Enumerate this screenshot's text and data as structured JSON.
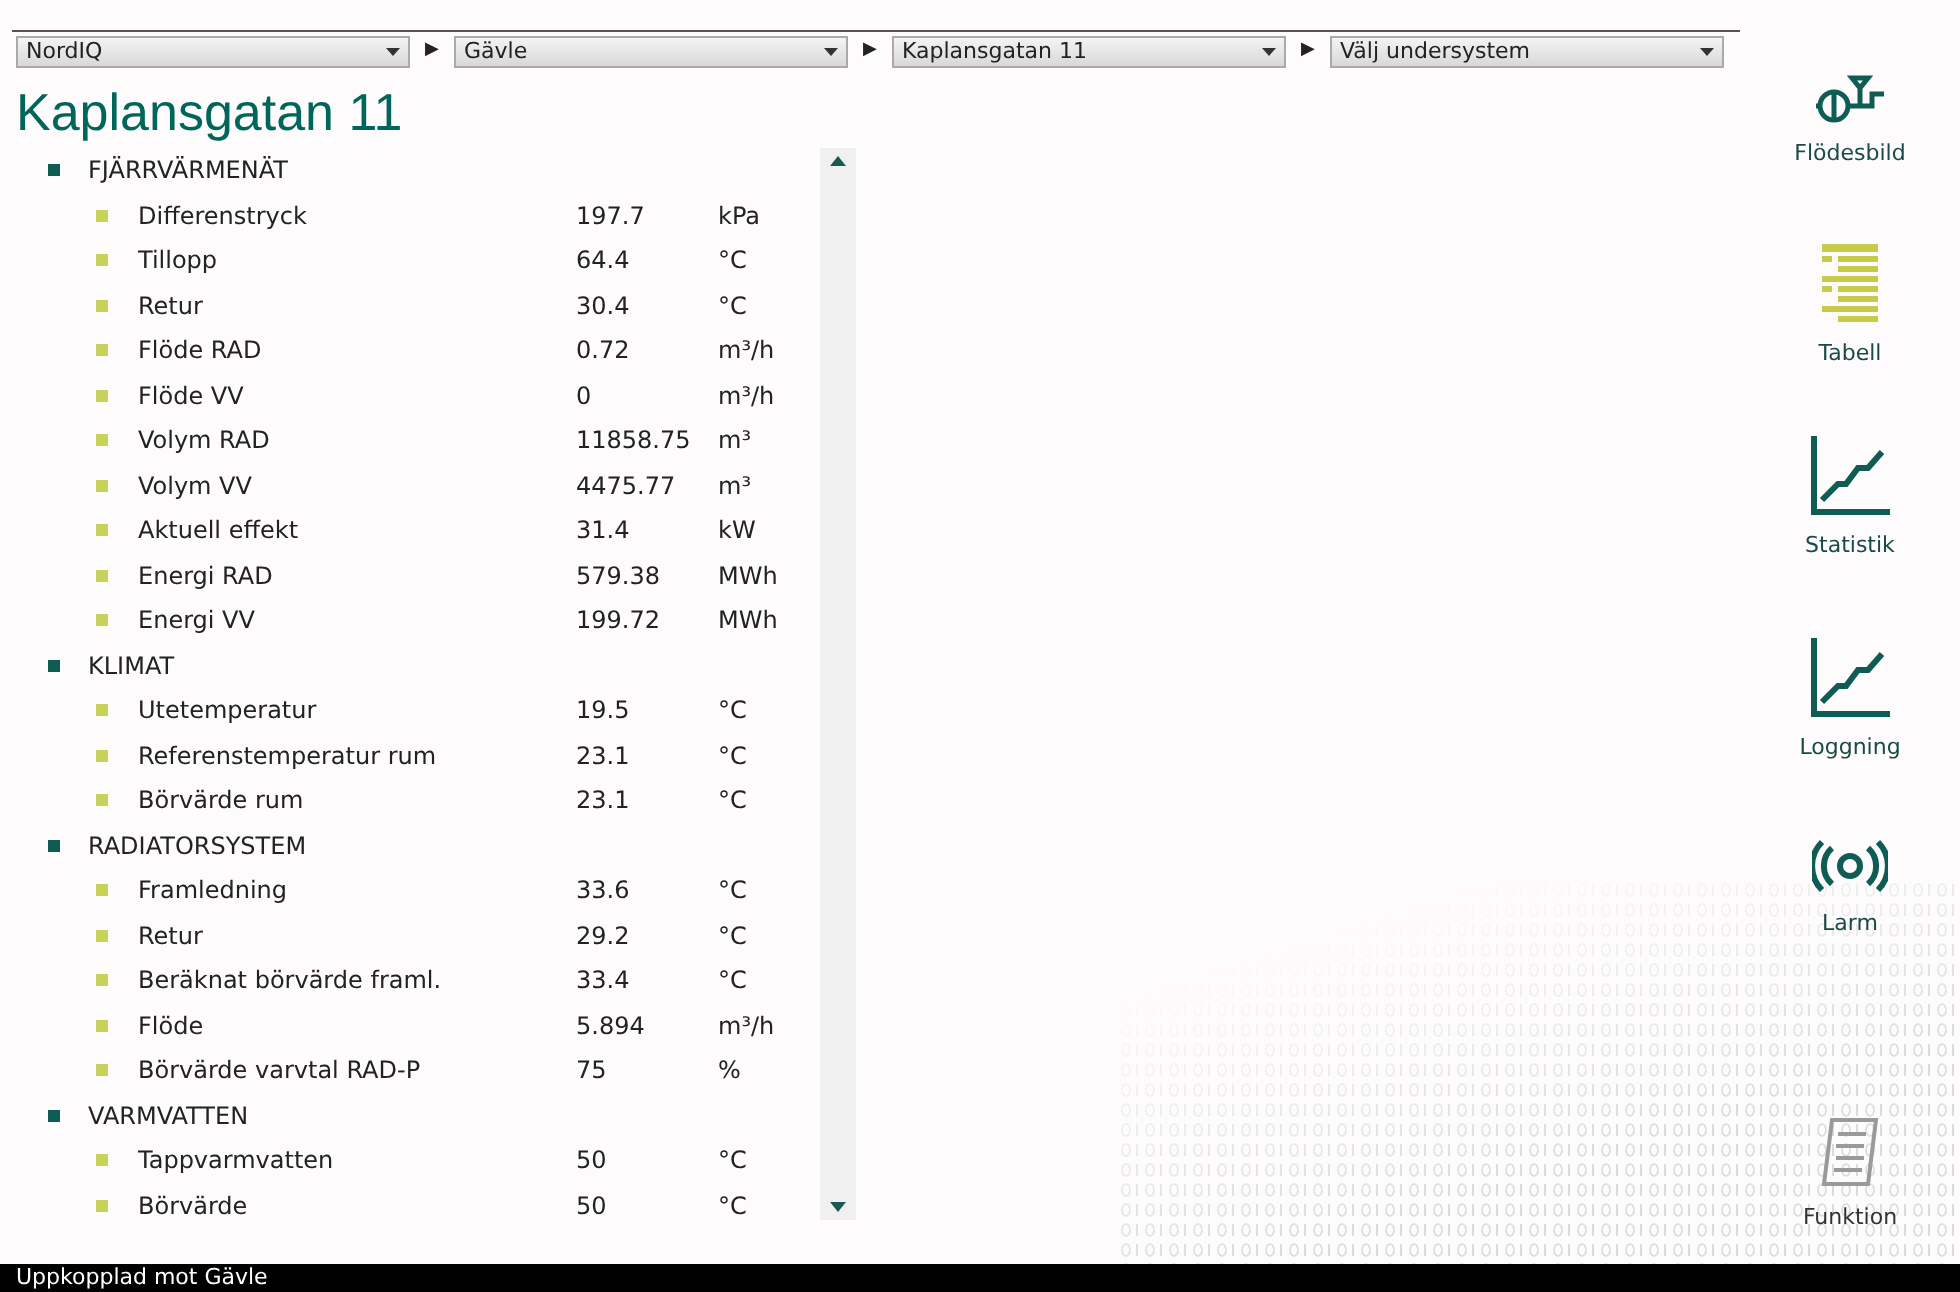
{
  "breadcrumb": [
    {
      "label": "NordIQ"
    },
    {
      "label": "Gävle"
    },
    {
      "label": "Kaplansgatan 11"
    },
    {
      "label": "Välj undersystem"
    }
  ],
  "separator": "▶",
  "title": "Kaplansgatan 11",
  "groups": [
    {
      "label": "FJÄRRVÄRMENÄT",
      "items": [
        {
          "name": "Differenstryck",
          "value": "197.7",
          "unit": "kPa"
        },
        {
          "name": "Tillopp",
          "value": "64.4",
          "unit": "°C"
        },
        {
          "name": "Retur",
          "value": "30.4",
          "unit": "°C"
        },
        {
          "name": "Flöde RAD",
          "value": "0.72",
          "unit": "m³/h"
        },
        {
          "name": "Flöde VV",
          "value": "0",
          "unit": "m³/h"
        },
        {
          "name": "Volym RAD",
          "value": "11858.75",
          "unit": "m³"
        },
        {
          "name": "Volym VV",
          "value": "4475.77",
          "unit": "m³"
        },
        {
          "name": "Aktuell effekt",
          "value": "31.4",
          "unit": "kW"
        },
        {
          "name": "Energi RAD",
          "value": "579.38",
          "unit": "MWh"
        },
        {
          "name": "Energi VV",
          "value": "199.72",
          "unit": "MWh"
        }
      ]
    },
    {
      "label": "KLIMAT",
      "items": [
        {
          "name": "Utetemperatur",
          "value": "19.5",
          "unit": "°C"
        },
        {
          "name": "Referenstemperatur rum",
          "value": "23.1",
          "unit": "°C"
        },
        {
          "name": "Börvärde rum",
          "value": "23.1",
          "unit": "°C"
        }
      ]
    },
    {
      "label": "RADIATORSYSTEM",
      "items": [
        {
          "name": "Framledning",
          "value": "33.6",
          "unit": "°C"
        },
        {
          "name": "Retur",
          "value": "29.2",
          "unit": "°C"
        },
        {
          "name": "Beräknat börvärde framl.",
          "value": "33.4",
          "unit": "°C"
        },
        {
          "name": "Flöde",
          "value": "5.894",
          "unit": "m³/h"
        },
        {
          "name": "Börvärde varvtal RAD-P",
          "value": "75",
          "unit": "%"
        }
      ]
    },
    {
      "label": "VARMVATTEN",
      "items": [
        {
          "name": "Tappvarmvatten",
          "value": "50",
          "unit": "°C"
        },
        {
          "name": "Börvärde",
          "value": "50",
          "unit": "°C"
        }
      ]
    }
  ],
  "nav": [
    {
      "kind": "flow",
      "label": "Flödesbild",
      "selected": false,
      "disabled": false
    },
    {
      "kind": "table",
      "label": "Tabell",
      "selected": true,
      "disabled": false
    },
    {
      "kind": "chart",
      "label": "Statistik",
      "selected": false,
      "disabled": false
    },
    {
      "kind": "chart",
      "label": "Loggning",
      "selected": false,
      "disabled": false
    },
    {
      "kind": "alarm",
      "label": "Larm",
      "selected": false,
      "disabled": false
    },
    {
      "kind": "document",
      "label": "Funktion",
      "selected": false,
      "disabled": true
    }
  ],
  "status_bar": "Uppkopplad mot Gävle"
}
